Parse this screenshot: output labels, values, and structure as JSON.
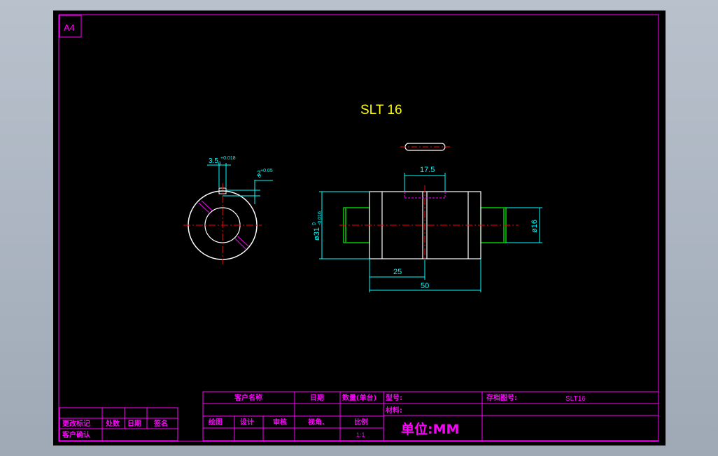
{
  "sheet": {
    "size_label": "A4",
    "title": "SLT 16"
  },
  "dimensions": {
    "keyway_width": "3.5",
    "keyway_width_tol": "+0.018",
    "keyway_width_tol_base": "0",
    "keyway_depth": "2",
    "keyway_depth_tol": "+0.05",
    "keyway_depth_tol_base": "0",
    "outer_diameter": "ø31",
    "outer_diameter_tol_upper": "0",
    "outer_diameter_tol_lower": "-0.016",
    "shaft_diameter": "ø16",
    "slot_length": "17.5",
    "half_length": "25",
    "total_length": "50"
  },
  "title_block": {
    "customer_name_label": "客户名称",
    "date_label": "日期",
    "quantity_label": "数量(单台)",
    "model_label": "型号:",
    "archive_no_label": "存档图号:",
    "archive_no_value": "SLT16",
    "material_label": "材料:",
    "drawn_label": "绘图",
    "design_label": "设计",
    "review_label": "审核",
    "view_angle_label": "视角.",
    "scale_label": "比例",
    "scale_value": "1:1",
    "unit_text": "单位:MM"
  },
  "revision_block": {
    "change_mark_label": "更改标记",
    "location_label": "处数",
    "date_label": "日期",
    "signature_label": "签名",
    "customer_confirm_label": "客户确认"
  },
  "colors": {
    "frame": "#ff00ff",
    "dimension": "#00ffff",
    "outline": "#ffffff",
    "centerline": "#ff0000",
    "hidden": "#ff00ff",
    "shaft_end": "#00ff00",
    "title_text": "#ffff00",
    "block_text": "#ff00ff"
  }
}
